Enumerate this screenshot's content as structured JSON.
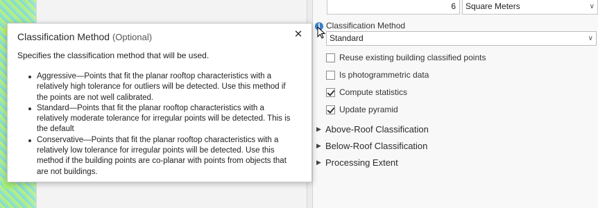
{
  "tooltip": {
    "title": "Classification Method",
    "optional": "(Optional)",
    "description": "Specifies the classification method that will be used.",
    "items": [
      "Aggressive—Points that fit the planar rooftop characteristics with a relatively high tolerance for outliers will be detected. Use this method if the points are not well calibrated.",
      "Standard—Points that fit the planar rooftop characteristics with a relatively moderate tolerance for irregular points will be detected. This is the default",
      "Conservative—Points that fit the planar rooftop characteristics with a relatively low tolerance for irregular points will be detected. Use this method if the building points are co-planar with points from objects that are not buildings."
    ],
    "close_icon": "close-icon"
  },
  "top_row": {
    "value": "6",
    "unit": "Square Meters"
  },
  "classification": {
    "label": "Classification Method",
    "selected": "Standard"
  },
  "checkboxes": [
    {
      "label": "Reuse existing building classified points",
      "checked": false
    },
    {
      "label": "Is photogrammetric data",
      "checked": false
    },
    {
      "label": "Compute statistics",
      "checked": true
    },
    {
      "label": "Update pyramid",
      "checked": true
    }
  ],
  "sections": [
    {
      "label": "Above-Roof Classification"
    },
    {
      "label": "Below-Roof Classification"
    },
    {
      "label": "Processing Extent"
    }
  ],
  "colors": {
    "info_icon": "#3b7fc4"
  }
}
